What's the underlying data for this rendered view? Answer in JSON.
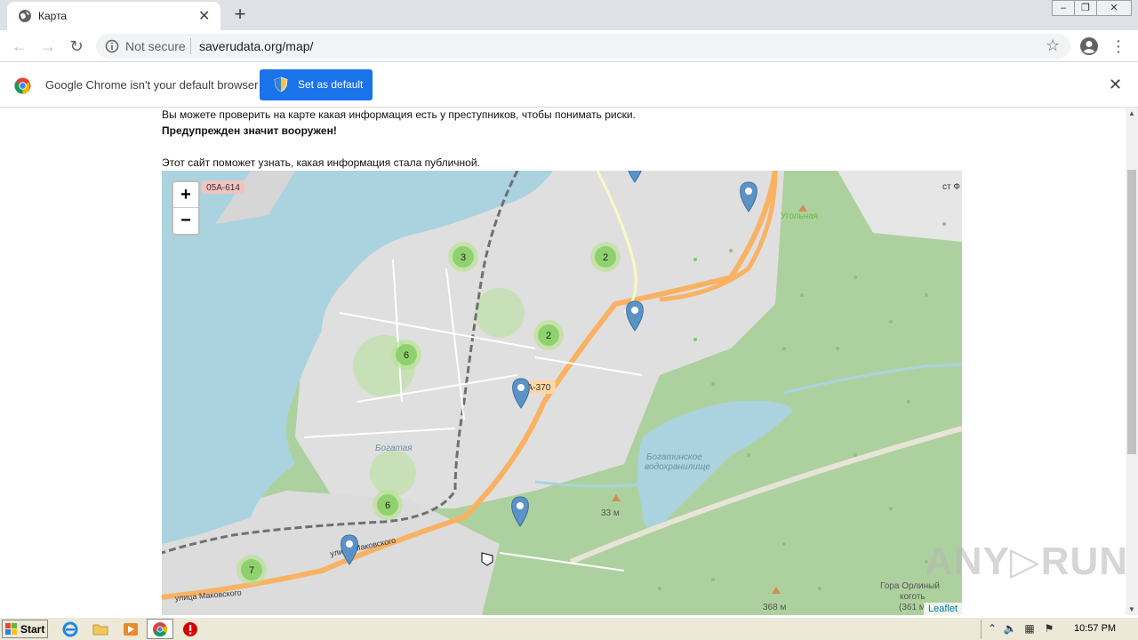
{
  "window": {
    "tab_title": "Карта",
    "new_tab_glyph": "+",
    "close_glyph": "✕",
    "controls": {
      "minimize": "–",
      "maximize": "❐",
      "close": "✕"
    }
  },
  "toolbar": {
    "back_glyph": "←",
    "forward_glyph": "→",
    "reload_glyph": "↻",
    "security_label": "Not secure",
    "url": "saverudata.org/map/",
    "star_glyph": "☆",
    "menu_glyph": "⋮"
  },
  "infobar": {
    "message": "Google Chrome isn't your default browser",
    "button_label": "Set as default",
    "close_glyph": "✕"
  },
  "page": {
    "line1": "Вы можете проверить на карте какая информация есть у преступников, чтобы понимать риски.",
    "line2": "Предупрежден значит вооружен!",
    "line3": "Этот сайт поможет узнать, какая информация стала публичной."
  },
  "map": {
    "zoom_in": "+",
    "zoom_out": "−",
    "attribution": "Leaflet",
    "labels": {
      "road_05a614": "05А-614",
      "road_a370": "А-370",
      "st_f": "ст Ф",
      "ugolnaya": "Угольная",
      "reservoir": "Богатинское водохранилище",
      "reservoir_line1": "Богатинское",
      "reservoir_line2": "водохранилище",
      "bogataya": "Богатая",
      "makovskogo": "улица Маковского",
      "elev_33": "33 м",
      "elev_368": "368 м",
      "gora": "Гора Орлиный",
      "kogot": "коготь",
      "elev_361": "(361 м"
    },
    "clusters": [
      "3",
      "2",
      "2",
      "6",
      "6",
      "7"
    ],
    "colors": {
      "water": "#aad3df",
      "forest": "#add19e",
      "urban": "#e0dfdf",
      "trunk": "#f9b264",
      "cluster": "#8fd16e",
      "marker": "#5b93c7"
    }
  },
  "taskbar": {
    "start_label": "Start",
    "clock": "10:57 PM",
    "icons": [
      "ie-icon",
      "folder-icon",
      "media-player-icon",
      "chrome-icon",
      "opera-icon"
    ]
  },
  "watermark": "ANY▷RUN"
}
